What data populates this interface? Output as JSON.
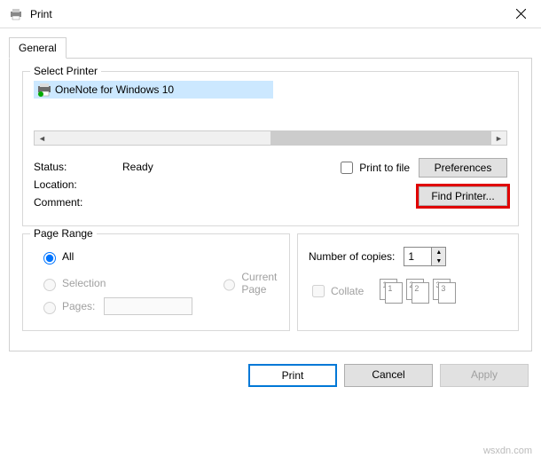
{
  "window": {
    "title": "Print"
  },
  "tabs": {
    "general": "General"
  },
  "printer_group": {
    "label": "Select Printer",
    "selected": "OneNote for Windows 10"
  },
  "status": {
    "status_label": "Status:",
    "status_value": "Ready",
    "location_label": "Location:",
    "location_value": "",
    "comment_label": "Comment:",
    "comment_value": ""
  },
  "actions": {
    "print_to_file": "Print to file",
    "preferences": "Preferences",
    "find_printer": "Find Printer..."
  },
  "page_range": {
    "label": "Page Range",
    "all": "All",
    "selection": "Selection",
    "current_page": "Current Page",
    "pages": "Pages:"
  },
  "copies": {
    "label": "Number of copies:",
    "value": "1",
    "collate": "Collate",
    "stack_labels": [
      "1",
      "2",
      "3"
    ]
  },
  "buttons": {
    "print": "Print",
    "cancel": "Cancel",
    "apply": "Apply"
  },
  "watermark": "wsxdn.com"
}
